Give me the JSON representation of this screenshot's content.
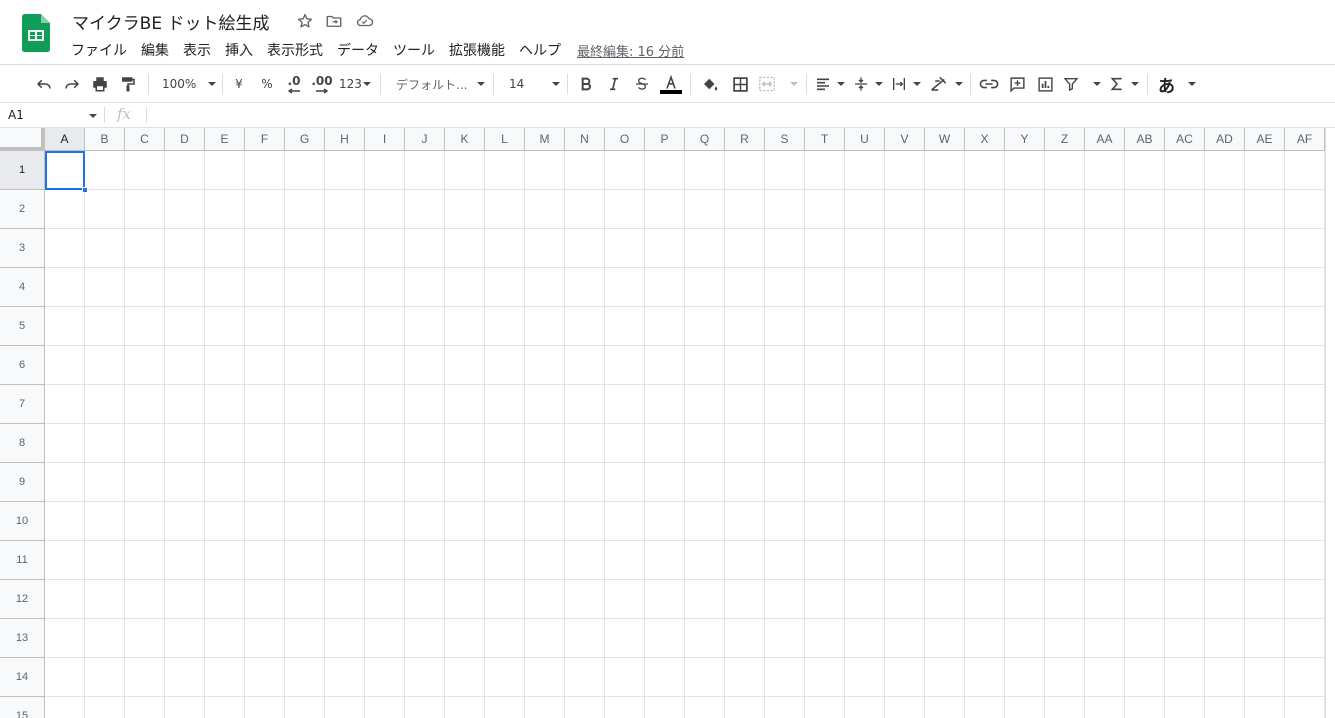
{
  "app": {
    "title": "マイクラBE ドット絵生成",
    "last_edit": "最終編集: 16 分前",
    "brand_color": "#0f9d58"
  },
  "menu": [
    "ファイル",
    "編集",
    "表示",
    "挿入",
    "表示形式",
    "データ",
    "ツール",
    "拡張機能",
    "ヘルプ"
  ],
  "toolbar": {
    "zoom": "100%",
    "currency": "¥",
    "percent": "%",
    "decimal_decrease": ".0",
    "decimal_increase": ".00",
    "more_formats": "123",
    "font": "デフォルト...",
    "font_size": "14",
    "input_tools": "あ",
    "text_color": "#000000"
  },
  "formula_bar": {
    "name_box": "A1",
    "fx": "fx",
    "formula": ""
  },
  "sheet": {
    "columns": [
      "A",
      "B",
      "C",
      "D",
      "E",
      "F",
      "G",
      "H",
      "I",
      "J",
      "K",
      "L",
      "M",
      "N",
      "O",
      "P",
      "Q",
      "R",
      "S",
      "T",
      "U",
      "V",
      "W",
      "X",
      "Y",
      "Z",
      "AA",
      "AB",
      "AC",
      "AD",
      "AE",
      "AF"
    ],
    "rows": [
      "1",
      "2",
      "3",
      "4",
      "5",
      "6",
      "7",
      "8",
      "9",
      "10",
      "11",
      "12",
      "13",
      "14",
      "15"
    ],
    "active_cell": "A1",
    "selection_color": "#1a73e8"
  }
}
